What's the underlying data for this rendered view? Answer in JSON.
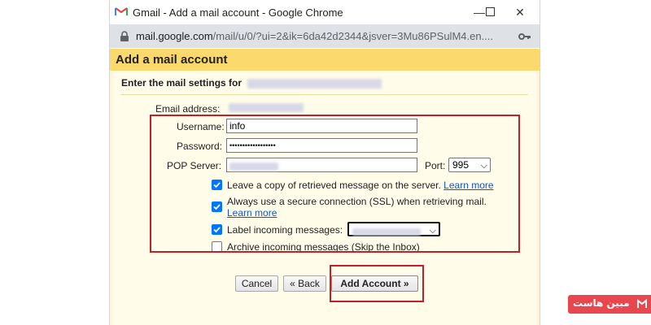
{
  "window": {
    "title": "Gmail - Add a mail account - Google Chrome",
    "url_host": "mail.google.com",
    "url_path": "/mail/u/0/?ui=2&ik=6da42d2344&jsver=3Mu86PSulM4.en...."
  },
  "dialog": {
    "title": "Add a mail account",
    "subheading": "Enter the mail settings for",
    "email_label": "Email address:",
    "username_label": "Username:",
    "username_value": "info",
    "password_label": "Password:",
    "password_value": "••••••••••••••••••",
    "pop_server_label": "POP Server:",
    "port_label": "Port:",
    "port_value": "995",
    "opt_leave_copy": "Leave a copy of retrieved message on the server.",
    "opt_ssl": "Always use a secure connection (SSL) when retrieving mail.",
    "opt_label_incoming": "Label incoming messages:",
    "opt_archive": "Archive incoming messages (Skip the Inbox)",
    "learn_more": "Learn more",
    "checkbox_states": {
      "leave_copy": true,
      "ssl": true,
      "label_incoming": true,
      "archive": false
    },
    "buttons": {
      "cancel": "Cancel",
      "back": "« Back",
      "add": "Add Account »"
    }
  },
  "watermark": {
    "text": "مبین هاست"
  },
  "colors": {
    "header": "#fbd96c",
    "panel": "#fff7d7",
    "highlight": "#c0202a",
    "checkbox": "#0075ff",
    "link": "#1155cc"
  }
}
